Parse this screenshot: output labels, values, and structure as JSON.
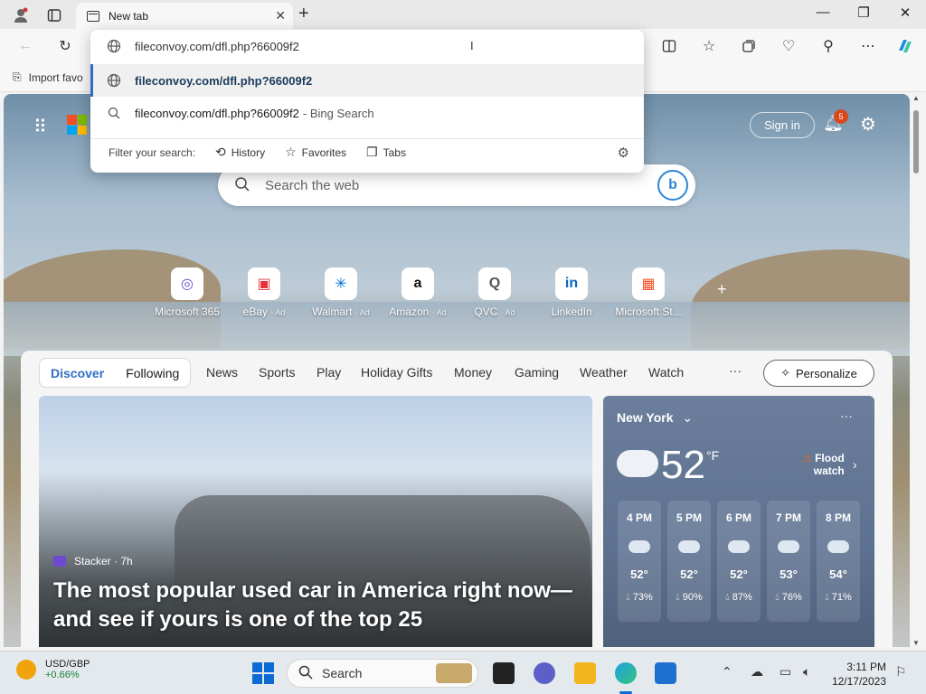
{
  "window": {
    "tab_title": "New tab",
    "new_tab_icon": "plus-icon",
    "controls": {
      "minimize": "—",
      "restore": "❐",
      "close": "✕"
    }
  },
  "toolbar": {
    "back_icon": "←",
    "refresh_icon": "↻"
  },
  "favorites_bar": {
    "import_label": "Import favo"
  },
  "omnibox": {
    "input_value": "fileconvoy.com/dfl.php?66009f2",
    "suggestions": [
      {
        "text": "fileconvoy.com/dfl.php?66009f2",
        "suffix": ""
      },
      {
        "text": "fileconvoy.com/dfl.php?66009f2",
        "suffix": "- Bing Search"
      }
    ],
    "filter_label": "Filter your search:",
    "filters": [
      "History",
      "Favorites",
      "Tabs"
    ]
  },
  "header": {
    "sign_in": "Sign in",
    "notification_count": "5"
  },
  "search": {
    "placeholder": "Search the web"
  },
  "quick_links": [
    {
      "label": "Microsoft 365",
      "ad": "",
      "glyph": "◎",
      "color": "#6b4fd8"
    },
    {
      "label": "eBay",
      "ad": "· Ad",
      "glyph": "▣",
      "color": "#e53238"
    },
    {
      "label": "Walmart",
      "ad": "· Ad",
      "glyph": "✳",
      "color": "#0071ce"
    },
    {
      "label": "Amazon",
      "ad": "· Ad",
      "glyph": "a",
      "color": "#111111"
    },
    {
      "label": "QVC",
      "ad": "· Ad",
      "glyph": "Q",
      "color": "#555555"
    },
    {
      "label": "LinkedIn",
      "ad": "",
      "glyph": "in",
      "color": "#0a66c2"
    },
    {
      "label": "Microsoft St...",
      "ad": "",
      "glyph": "▦",
      "color": "#f25022"
    }
  ],
  "feed": {
    "discover": "Discover",
    "following": "Following",
    "categories": [
      "News",
      "Sports",
      "Play",
      "Holiday Gifts",
      "Money",
      "Gaming",
      "Weather",
      "Watch"
    ],
    "more": "···",
    "personalize": "Personalize"
  },
  "hero": {
    "source": "Stacker · 7h",
    "headline": "The most popular used car in America right now—and see if yours is one of the top 25"
  },
  "weather": {
    "city": "New York",
    "temp": "52",
    "unit": "°F",
    "alert_line1": "Flood",
    "alert_line2": "watch",
    "hourly": [
      {
        "time": "4 PM",
        "temp": "52°",
        "humidity": "73%"
      },
      {
        "time": "5 PM",
        "temp": "52°",
        "humidity": "90%"
      },
      {
        "time": "6 PM",
        "temp": "52°",
        "humidity": "87%"
      },
      {
        "time": "7 PM",
        "temp": "53°",
        "humidity": "76%"
      },
      {
        "time": "8 PM",
        "temp": "54°",
        "humidity": "71%"
      }
    ]
  },
  "taskbar": {
    "widget_title": "USD/GBP",
    "widget_value": "+0.66%",
    "search_label": "Search",
    "time": "3:11 PM",
    "date": "12/17/2023"
  },
  "colors": {
    "accent": "#2f6fc3",
    "notification": "#d9481b",
    "positive": "#188038"
  }
}
